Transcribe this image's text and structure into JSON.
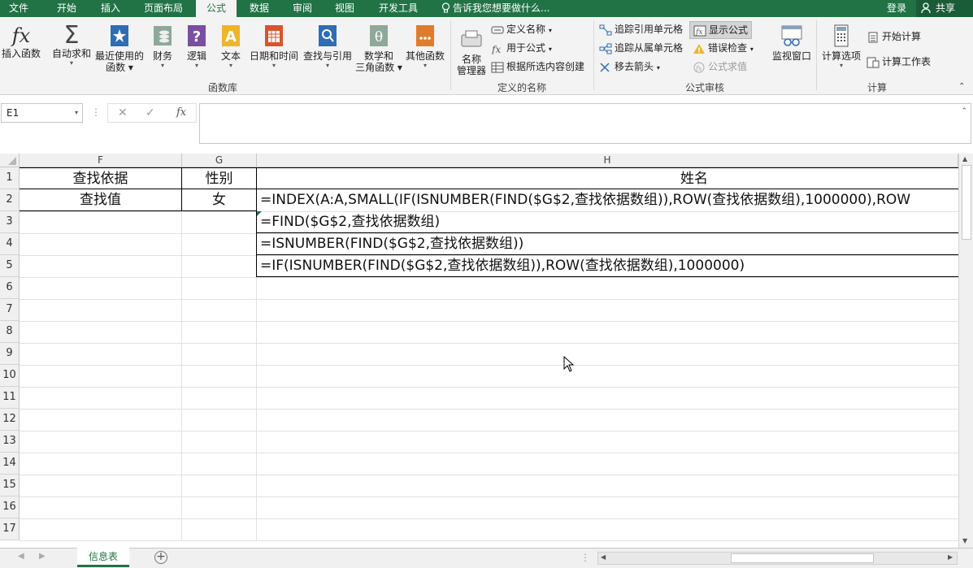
{
  "menu": {
    "tabs": [
      {
        "label": "文件"
      },
      {
        "label": "开始"
      },
      {
        "label": "插入"
      },
      {
        "label": "页面布局"
      },
      {
        "label": "公式",
        "active": true
      },
      {
        "label": "数据"
      },
      {
        "label": "审阅"
      },
      {
        "label": "视图"
      },
      {
        "label": "开发工具"
      }
    ],
    "tell_me": "告诉我您想要做什么...",
    "login": "登录",
    "share": "共享"
  },
  "ribbon": {
    "insert_function": "插入函数",
    "autosum": "自动求和",
    "recent_l1": "最近使用的",
    "recent_l2": "函数",
    "financial": "财务",
    "logical": "逻辑",
    "text": "文本",
    "datetime": "日期和时间",
    "lookup": "查找与引用",
    "math_l1": "数学和",
    "math_l2": "三角函数",
    "other": "其他函数",
    "group_library": "函数库",
    "name_mgr_l1": "名称",
    "name_mgr_l2": "管理器",
    "define_name": "定义名称",
    "use_in_formula": "用于公式",
    "create_from_sel": "根据所选内容创建",
    "group_names": "定义的名称",
    "trace_precedents": "追踪引用单元格",
    "trace_dependents": "追踪从属单元格",
    "remove_arrows": "移去箭头",
    "show_formulas": "显示公式",
    "error_check": "错误检查",
    "evaluate": "公式求值",
    "watch_window": "监视窗口",
    "group_auditing": "公式审核",
    "calc_options": "计算选项",
    "calc_now": "开始计算",
    "calc_sheet": "计算工作表",
    "group_calc": "计算",
    "accent": "#217346"
  },
  "formula_bar": {
    "name_box": "E1",
    "content": ""
  },
  "grid": {
    "columns": [
      "F",
      "G",
      "H"
    ],
    "rows": [
      "1",
      "2",
      "3",
      "4",
      "5",
      "6",
      "7",
      "8",
      "9",
      "10",
      "11",
      "12",
      "13",
      "14",
      "15",
      "16",
      "17"
    ],
    "cells": {
      "F1": "查找依据",
      "G1": "性别",
      "H1": "姓名",
      "F2": "查找值",
      "G2": "女",
      "H2": "=INDEX(A:A,SMALL(IF(ISNUMBER(FIND($G$2,查找依据数组)),ROW(查找依据数组),1000000),ROW",
      "H3": "=FIND($G$2,查找依据数组)",
      "H4": "=ISNUMBER(FIND($G$2,查找依据数组))",
      "H5": "=IF(ISNUMBER(FIND($G$2,查找依据数组)),ROW(查找依据数组),1000000)"
    }
  },
  "sheets": {
    "active": "信息表"
  }
}
